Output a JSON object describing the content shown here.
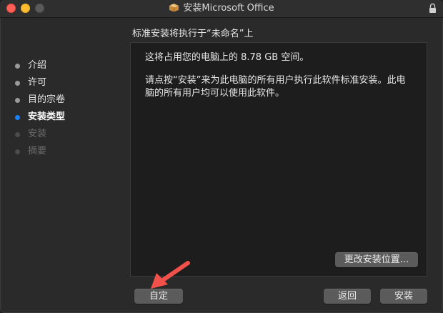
{
  "window": {
    "title": "安装Microsoft Office"
  },
  "heading": "标准安装将执行于“未命名”上",
  "steps": [
    {
      "label": "介绍",
      "state": "done"
    },
    {
      "label": "许可",
      "state": "done"
    },
    {
      "label": "目的宗卷",
      "state": "done"
    },
    {
      "label": "安装类型",
      "state": "active"
    },
    {
      "label": "安装",
      "state": "pending"
    },
    {
      "label": "摘要",
      "state": "pending"
    }
  ],
  "content": {
    "space_text": "这将占用您的电脑上的 8.78 GB 空间。",
    "description": "请点按“安装”来为此电脑的所有用户执行此软件标准安装。此电脑的所有用户均可以使用此软件。",
    "change_location_label": "更改安装位置..."
  },
  "buttons": {
    "customize": "自定",
    "back": "返回",
    "install": "安装"
  },
  "colors": {
    "active_step_dot": "#1a82fb",
    "annotation_arrow": "#f2504b"
  },
  "icons": {
    "title_icon": "package-icon",
    "lock": "lock-icon"
  }
}
